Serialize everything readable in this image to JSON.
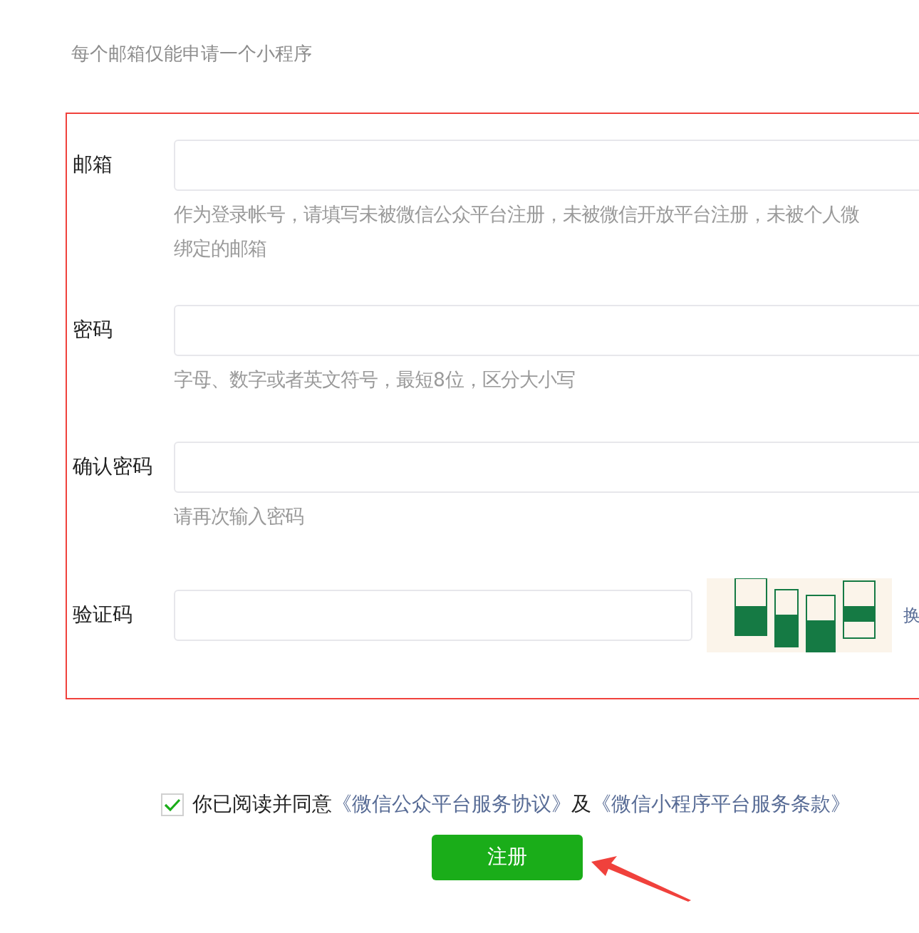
{
  "notice": "每个邮箱仅能申请一个小程序",
  "fields": [
    {
      "kind": "text",
      "label": "邮箱",
      "hints": [
        "作为登录帐号，请填写未被微信公众平台注册，未被微信开放平台注册，未被个人微",
        "绑定的邮箱"
      ]
    },
    {
      "kind": "text",
      "label": "密码",
      "hints": [
        "字母、数字或者英文符号，最短8位，区分大小写"
      ]
    },
    {
      "kind": "text",
      "label": "确认密码",
      "hints": [
        "请再次输入密码"
      ]
    },
    {
      "kind": "captcha",
      "label": "验证码",
      "refresh": "换"
    }
  ],
  "agreement": {
    "checked": true,
    "parts": [
      {
        "kind": "plain",
        "text": "你已阅读并同意"
      },
      {
        "kind": "link",
        "text": "《微信公众平台服务协议》"
      },
      {
        "kind": "plain",
        "text": "及"
      },
      {
        "kind": "link",
        "text": "《微信小程序平台服务条款》"
      }
    ]
  },
  "submit": "注册"
}
